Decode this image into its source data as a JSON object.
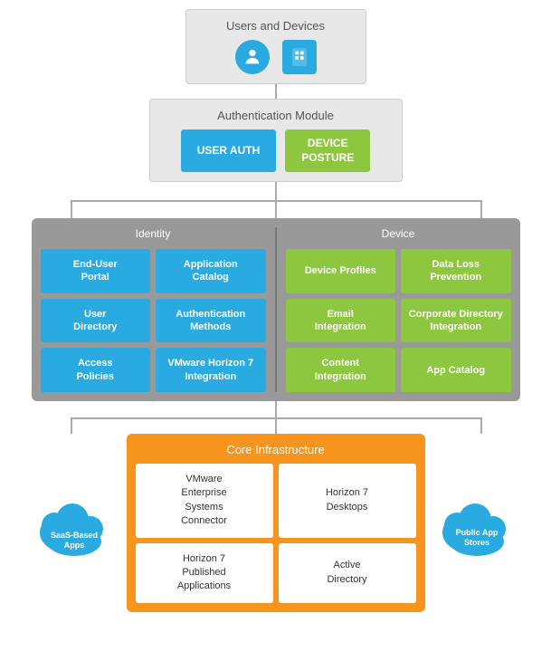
{
  "users_devices": {
    "label": "Users and Devices"
  },
  "auth_module": {
    "label": "Authentication Module",
    "btn_user_auth": "USER AUTH",
    "btn_device_posture": "DEVICE\nPOSTURE"
  },
  "identity_section": {
    "label": "Identity",
    "cells": [
      "End-User Portal",
      "Application Catalog",
      "User Directory",
      "Authentication Methods",
      "Access Policies",
      "VMware Horizon 7 Integration"
    ]
  },
  "device_section": {
    "label": "Device",
    "cells": [
      "Device Profiles",
      "Data Loss Prevention",
      "Email Integration",
      "Corporate Directory Integration",
      "Content Integration",
      "App Catalog"
    ]
  },
  "core_infra": {
    "label": "Core Infrastructure",
    "cells": [
      "VMware Enterprise Systems Connector",
      "Horizon 7 Desktops",
      "Horizon 7 Published Applications",
      "Active Directory"
    ]
  },
  "cloud_left": {
    "label": "SaaS-Based Apps"
  },
  "cloud_right": {
    "label": "Public App Stores"
  }
}
